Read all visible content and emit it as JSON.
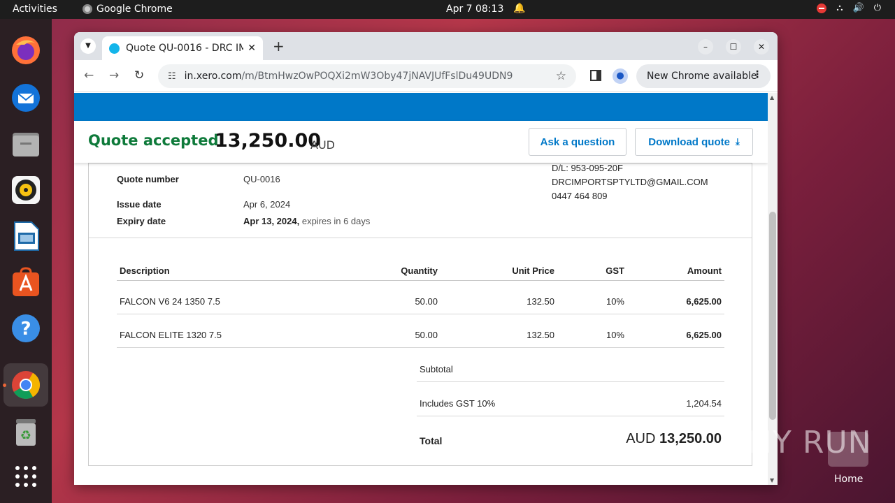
{
  "topbar": {
    "activities": "Activities",
    "app_name": "Google Chrome",
    "clock": "Apr 7  08:13"
  },
  "dock": {
    "items": [
      "firefox",
      "thunderbird",
      "files",
      "rhythmbox",
      "libreoffice-impress",
      "app-center",
      "help",
      "google-chrome",
      "trash",
      "show-apps"
    ]
  },
  "browser": {
    "tab_title": "Quote QU-0016 - DRC IM",
    "url_host": "in.xero.com",
    "url_path": "/m/BtmHwzOwPOQXi2mW3Oby47jNAVJUfFslDu49UDN9",
    "update_chip": "New Chrome available"
  },
  "quote": {
    "status": "Quote accepted",
    "total_amount": "13,250.00",
    "currency": "AUD",
    "ask_button": "Ask a question",
    "download_button": "Download quote",
    "meta": {
      "quote_number_label": "Quote number",
      "quote_number": "QU-0016",
      "issue_date_label": "Issue date",
      "issue_date": "Apr 6, 2024",
      "expiry_date_label": "Expiry date",
      "expiry_date": "Apr 13, 2024,",
      "expiry_note": "expires in 6 days"
    },
    "contact": {
      "dl": "D/L: 953-095-20F",
      "email": "DRCIMPORTSPTYLTD@GMAIL.COM",
      "phone": "0447 464 809"
    },
    "table": {
      "headers": {
        "description": "Description",
        "quantity": "Quantity",
        "unit_price": "Unit Price",
        "gst": "GST",
        "amount": "Amount"
      },
      "rows": [
        {
          "description": "FALCON V6 24 1350 7.5",
          "quantity": "50.00",
          "unit_price": "132.50",
          "gst": "10%",
          "amount": "6,625.00"
        },
        {
          "description": "FALCON ELITE 1320 7.5",
          "quantity": "50.00",
          "unit_price": "132.50",
          "gst": "10%",
          "amount": "6,625.00"
        }
      ]
    },
    "summary": {
      "subtotal_label": "Subtotal",
      "gst_label": "Includes GST 10%",
      "gst_value": "1,204.54",
      "total_label": "Total",
      "total_currency": "AUD",
      "total_value": "13,250.00"
    }
  },
  "desktop": {
    "home_label": "Home",
    "watermark": "ANY RUN"
  }
}
